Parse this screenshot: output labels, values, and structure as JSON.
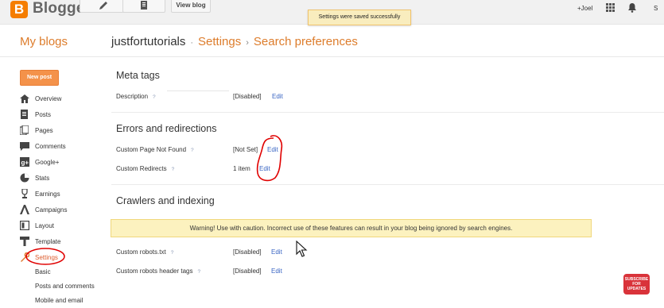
{
  "topbar": {
    "logo_letter": "B",
    "logo_text": "Blogger",
    "view_blog": "View blog",
    "toast": "Settings were saved successfully",
    "user": "+Joel",
    "share_initial": "S"
  },
  "header": {
    "my_blogs": "My blogs",
    "blog_name": "justfortutorials",
    "sep1": "·",
    "crumb_settings": "Settings",
    "sep2": "›",
    "crumb_page": "Search preferences"
  },
  "sidebar": {
    "new_post": "New post",
    "items": [
      {
        "label": "Overview",
        "icon": "home-icon"
      },
      {
        "label": "Posts",
        "icon": "posts-icon"
      },
      {
        "label": "Pages",
        "icon": "pages-icon"
      },
      {
        "label": "Comments",
        "icon": "comments-icon"
      },
      {
        "label": "Google+",
        "icon": "google-plus-icon"
      },
      {
        "label": "Stats",
        "icon": "stats-icon"
      },
      {
        "label": "Earnings",
        "icon": "trophy-icon"
      },
      {
        "label": "Campaigns",
        "icon": "campaigns-icon"
      },
      {
        "label": "Layout",
        "icon": "layout-icon"
      },
      {
        "label": "Template",
        "icon": "template-icon"
      },
      {
        "label": "Settings",
        "icon": "wrench-icon"
      }
    ],
    "sub_items": [
      "Basic",
      "Posts and comments",
      "Mobile and email"
    ]
  },
  "main": {
    "meta": {
      "title": "Meta tags",
      "rows": [
        {
          "label": "Description",
          "q": "?",
          "value": "[Disabled]",
          "edit": "Edit"
        }
      ]
    },
    "errors": {
      "title": "Errors and redirections",
      "rows": [
        {
          "label": "Custom Page Not Found",
          "q": "?",
          "value": "[Not Set]",
          "edit": "Edit"
        },
        {
          "label": "Custom Redirects",
          "q": "?",
          "value": "1 item",
          "edit": "Edit"
        }
      ]
    },
    "crawlers": {
      "title": "Crawlers and indexing",
      "warning": "Warning! Use with caution. Incorrect use of these features can result in your blog being ignored by search engines.",
      "rows": [
        {
          "label": "Custom robots.txt",
          "q": "?",
          "value": "[Disabled]",
          "edit": "Edit"
        },
        {
          "label": "Custom robots header tags",
          "q": "?",
          "value": "[Disabled]",
          "edit": "Edit"
        }
      ]
    }
  },
  "overlay": {
    "subscribe_badge": "SUBSCRIBE FOR UPDATES"
  },
  "colors": {
    "accent": "#dd7c2b",
    "link": "#3a66c4",
    "annotation": "#e00000"
  }
}
